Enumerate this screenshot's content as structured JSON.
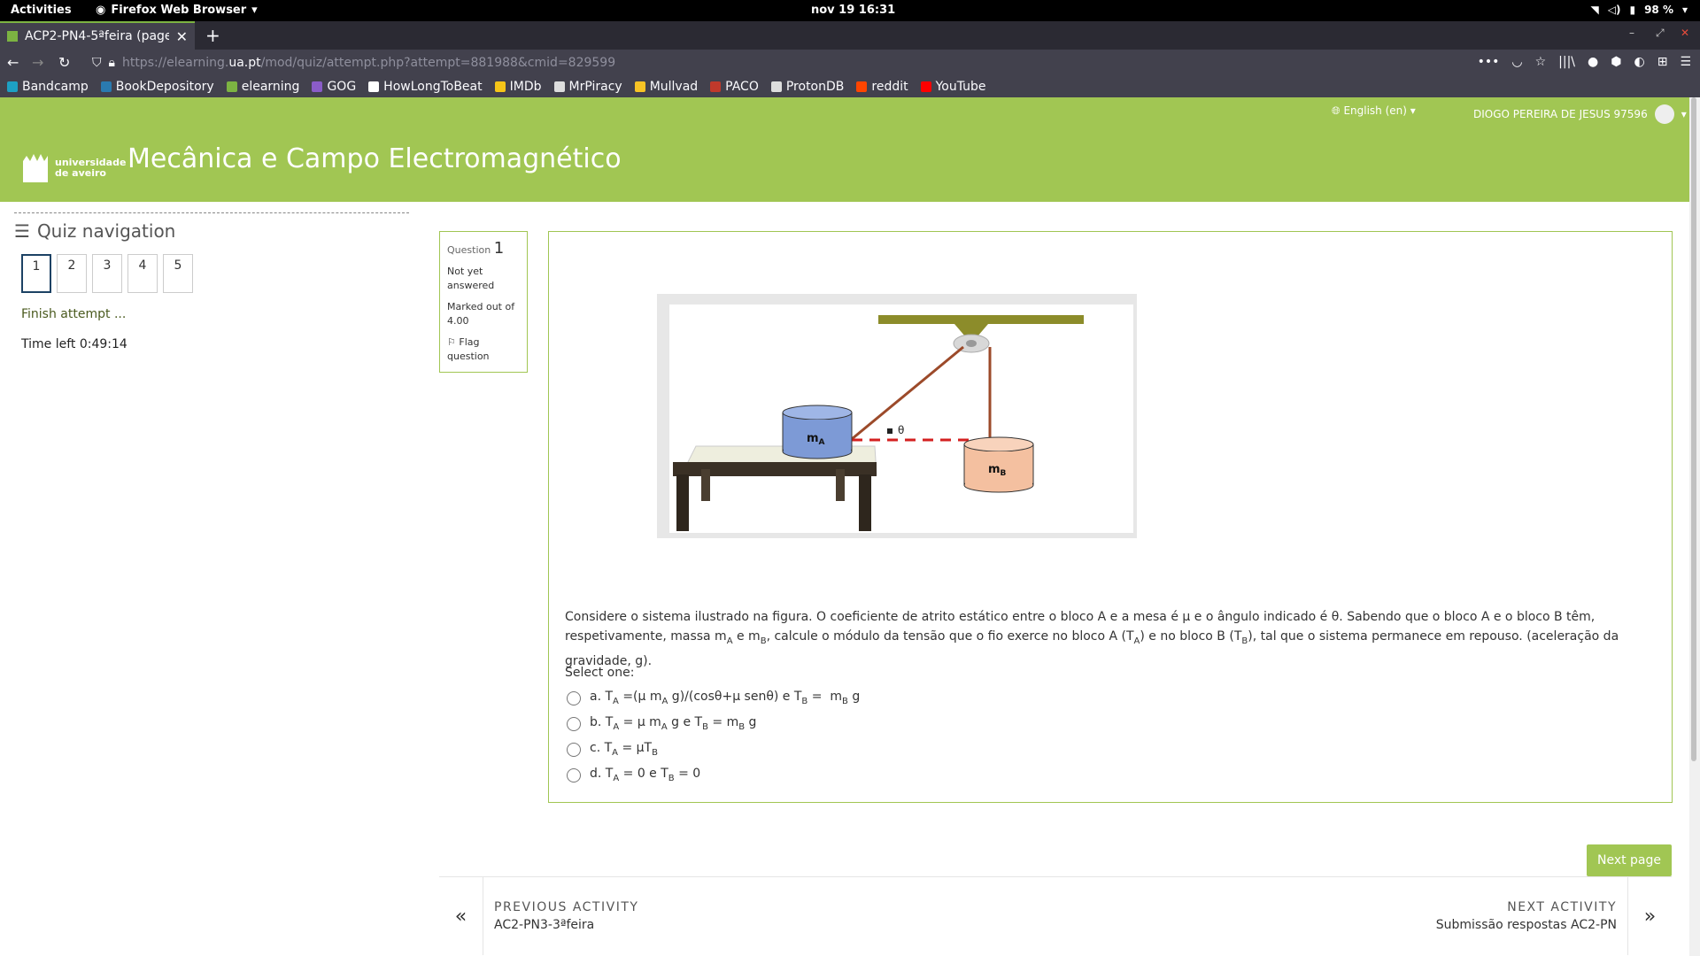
{
  "gnome": {
    "activities": "Activities",
    "app": "Firefox Web Browser",
    "clock": "nov 19  16:31",
    "battery": "98 %"
  },
  "browser": {
    "tab_title": "ACP2-PN4-5ªfeira (page",
    "url_prefix": "https://elearning.",
    "url_domain": "ua.pt",
    "url_path": "/mod/quiz/attempt.php?attempt=881988&cmid=829599"
  },
  "bookmarks": [
    {
      "label": "Bandcamp",
      "color": "#1da0c3"
    },
    {
      "label": "BookDepository",
      "color": "#2a7ab0"
    },
    {
      "label": "elearning",
      "color": "#7cb342"
    },
    {
      "label": "GOG",
      "color": "#8a5cc8"
    },
    {
      "label": "HowLongToBeat",
      "color": "#ffffff"
    },
    {
      "label": "IMDb",
      "color": "#f5c518"
    },
    {
      "label": "MrPiracy",
      "color": "#dddddd"
    },
    {
      "label": "Mullvad",
      "color": "#f7c325"
    },
    {
      "label": "PACO",
      "color": "#c0392b"
    },
    {
      "label": "ProtonDB",
      "color": "#dddddd"
    },
    {
      "label": "reddit",
      "color": "#ff4500"
    },
    {
      "label": "YouTube",
      "color": "#ff0000"
    }
  ],
  "moodle": {
    "language": "English (en) ▾",
    "user": "DIOGO PEREIRA DE JESUS 97596",
    "logo_line1": "universidade",
    "logo_line2": "de aveiro",
    "course": "Mecânica e Campo Electromagnético"
  },
  "quiz_nav": {
    "title": "Quiz navigation",
    "questions": [
      "1",
      "2",
      "3",
      "4",
      "5"
    ],
    "finish": "Finish attempt ...",
    "time_label": "Time left",
    "time_value": "0:49:14"
  },
  "qinfo": {
    "question_label": "Question",
    "number": "1",
    "status": "Not yet answered",
    "marked": "Marked out of 4.00",
    "flag": "Flag question"
  },
  "figure": {
    "label_a": "mA",
    "label_b": "mB",
    "theta": "θ"
  },
  "question": {
    "select": "Select one:"
  },
  "buttons": {
    "next_page": "Next page"
  },
  "activity_nav": {
    "prev_label": "PREVIOUS ACTIVITY",
    "prev_name": "AC2-PN3-3ªfeira",
    "next_label": "NEXT ACTIVITY",
    "next_name": "Submissão respostas AC2-PN"
  },
  "colors": {
    "moodle_green": "#a1c653"
  }
}
